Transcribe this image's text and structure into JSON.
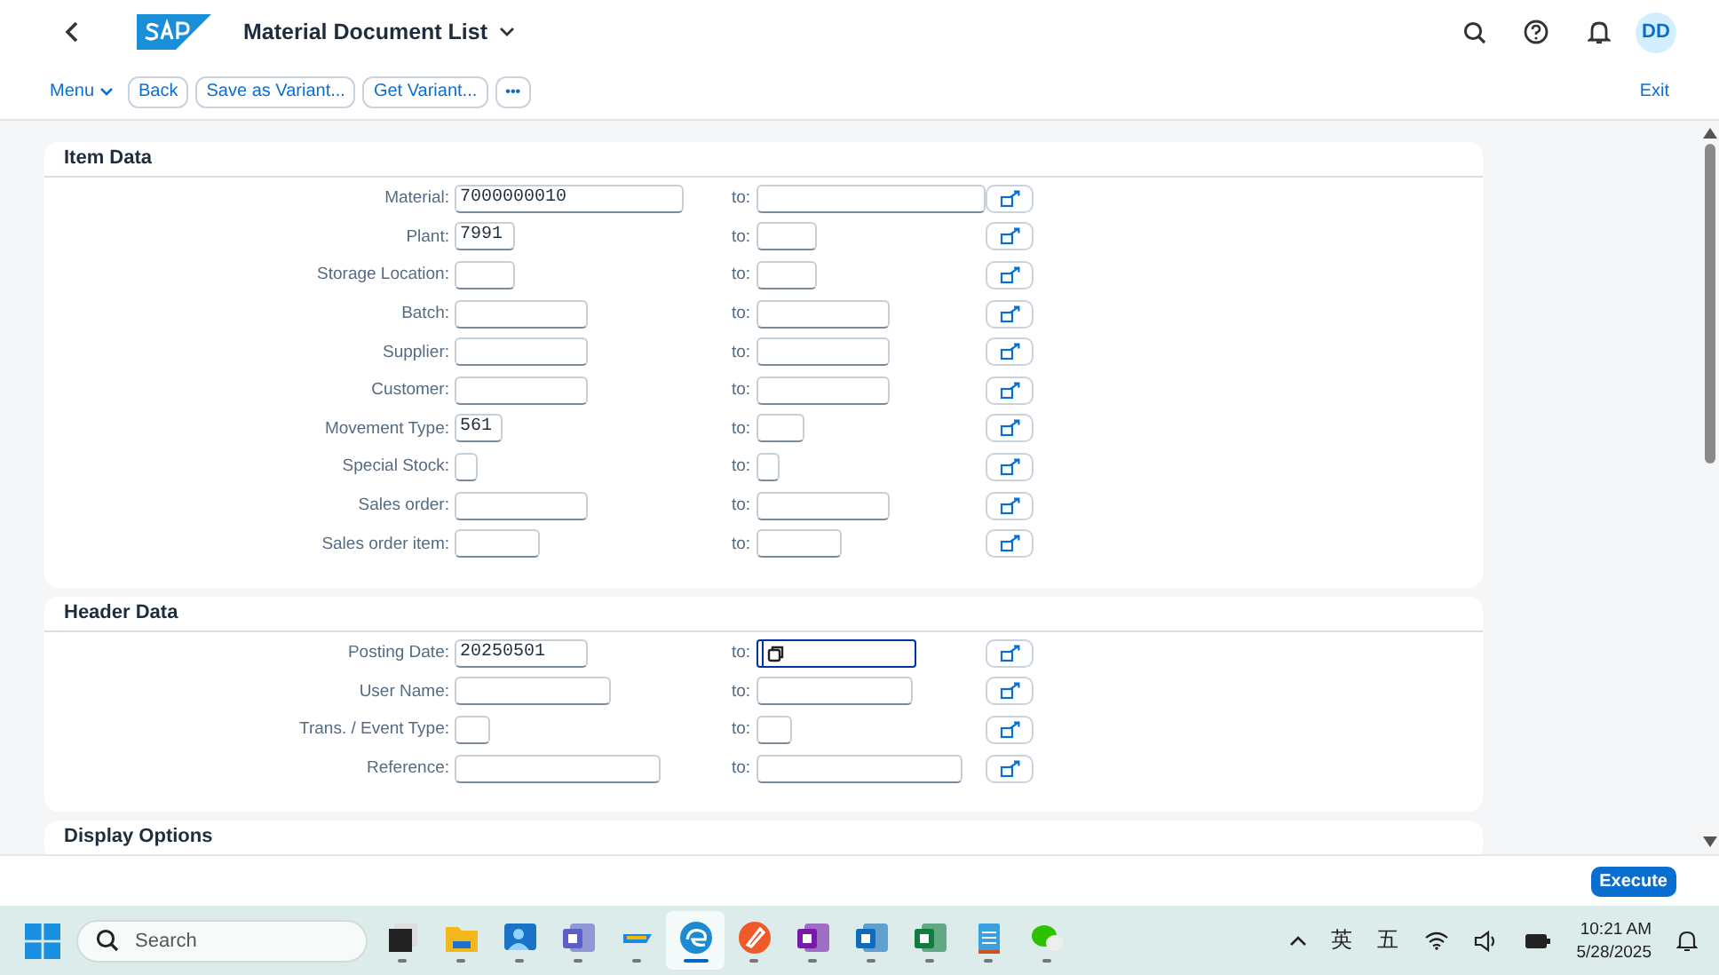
{
  "shell": {
    "title": "Material Document List",
    "avatar": "DD"
  },
  "toolbar": {
    "menu": "Menu",
    "buttons": [
      "Back",
      "Save as Variant...",
      "Get Variant..."
    ],
    "more": "•••",
    "exit": "Exit"
  },
  "sections": [
    {
      "title": "Item Data",
      "rows": [
        {
          "label": "Material:",
          "from": "7000000010",
          "to_label": "to:",
          "to": "",
          "to_focused": false
        },
        {
          "label": "Plant:",
          "from": "7991",
          "to_label": "to:",
          "to": "",
          "to_focused": false
        },
        {
          "label": "Storage Location:",
          "from": "",
          "to_label": "to:",
          "to": "",
          "to_focused": false
        },
        {
          "label": "Batch:",
          "from": "",
          "to_label": "to:",
          "to": "",
          "to_focused": false
        },
        {
          "label": "Supplier:",
          "from": "",
          "to_label": "to:",
          "to": "",
          "to_focused": false
        },
        {
          "label": "Customer:",
          "from": "",
          "to_label": "to:",
          "to": "",
          "to_focused": false
        },
        {
          "label": "Movement Type:",
          "from": "561",
          "to_label": "to:",
          "to": "",
          "to_focused": false
        },
        {
          "label": "Special Stock:",
          "from": "",
          "to_label": "to:",
          "to": "",
          "to_focused": false
        },
        {
          "label": "Sales order:",
          "from": "",
          "to_label": "to:",
          "to": "",
          "to_focused": false
        },
        {
          "label": "Sales order item:",
          "from": "",
          "to_label": "to:",
          "to": "",
          "to_focused": false
        }
      ]
    },
    {
      "title": "Header Data",
      "rows": [
        {
          "label": "Posting Date:",
          "from": "20250501",
          "to_label": "to:",
          "to": "",
          "to_focused": true
        },
        {
          "label": "User Name:",
          "from": "",
          "to_label": "to:",
          "to": "",
          "to_focused": false
        },
        {
          "label": "Trans. / Event Type:",
          "from": "",
          "to_label": "to:",
          "to": "",
          "to_focused": false
        },
        {
          "label": "Reference:",
          "from": "",
          "to_label": "to:",
          "to": "",
          "to_focused": false
        }
      ]
    },
    {
      "title": "Display Options"
    }
  ],
  "footer": {
    "execute": "Execute"
  },
  "taskbar": {
    "search_placeholder": "Search",
    "apps": [
      {
        "kind": "task-view",
        "selected": false
      },
      {
        "kind": "folder",
        "selected": false
      },
      {
        "kind": "person-app",
        "selected": false
      },
      {
        "kind": "teams",
        "selected": false
      },
      {
        "kind": "tag-app",
        "selected": false
      },
      {
        "kind": "browser",
        "selected": true
      },
      {
        "kind": "pen-app",
        "selected": false
      },
      {
        "kind": "onenote",
        "selected": false
      },
      {
        "kind": "outlook",
        "selected": false
      },
      {
        "kind": "excel",
        "selected": false
      },
      {
        "kind": "notepad",
        "selected": false
      },
      {
        "kind": "chat",
        "selected": false
      }
    ],
    "ime_1": "英",
    "ime_2": "五",
    "time": "10:21 AM",
    "date": "5/28/2025"
  }
}
